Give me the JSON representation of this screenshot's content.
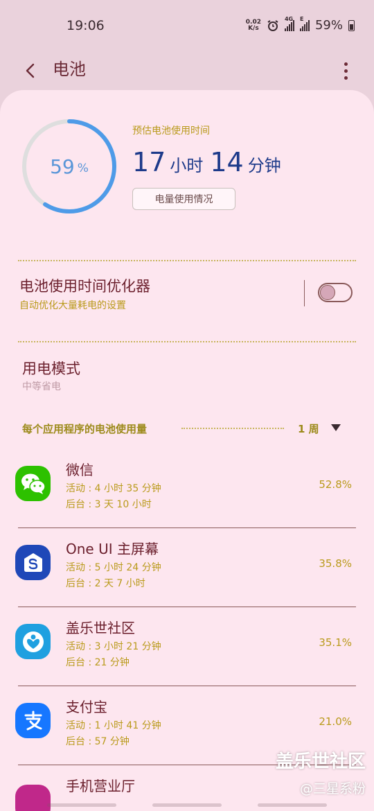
{
  "status_bar": {
    "time": "19:06",
    "net_speed_value": "0.02",
    "net_speed_unit": "K/s",
    "icons": [
      "alarm-icon",
      "4g-signal-icon",
      "e-signal-icon",
      "battery-icon"
    ],
    "net_4g": "4G",
    "net_e": "E",
    "battery": "59%"
  },
  "app_bar": {
    "title": "电池",
    "back_icon": "chevron-left-icon",
    "more_icon": "more-vertical-icon"
  },
  "battery": {
    "level_fraction": 0.59,
    "level_number": "59",
    "level_unit": "%",
    "ring_color": "#4e9be8",
    "estimate_label": "预估电池使用时间",
    "hours": "17",
    "hours_unit": "小时",
    "minutes": "14",
    "minutes_unit": "分钟",
    "usage_button": "电量使用情况"
  },
  "optimizer": {
    "title": "电池使用时间优化器",
    "subtitle": "自动优化大量耗电的设置",
    "enabled": false
  },
  "power_mode": {
    "title": "用电模式",
    "subtitle": "中等省电"
  },
  "app_usage": {
    "section_label": "每个应用程序的电池使用量",
    "period": "1 周",
    "apps": [
      {
        "name": "微信",
        "foreground": "活动 : 4 小时 35 分钟",
        "background": "后台 : 3 天 10 小时",
        "percent": "52.8%",
        "icon": "wechat-icon",
        "color": "#2dc100"
      },
      {
        "name": "One UI 主屏幕",
        "foreground": "活动 : 5 小时 24 分钟",
        "background": "后台 : 2 天 7 小时",
        "percent": "35.8%",
        "icon": "oneui-home-icon",
        "color": "#1f48b8"
      },
      {
        "name": "盖乐世社区",
        "foreground": "活动 : 3 小时 21 分钟",
        "background": "后台 : 21 分钟",
        "percent": "35.1%",
        "icon": "galaxy-community-icon",
        "color": "#1fa0e0"
      },
      {
        "name": "支付宝",
        "foreground": "活动 : 1 小时 41 分钟",
        "background": "后台 : 57 分钟",
        "percent": "21.0%",
        "icon": "alipay-icon",
        "color": "#1677ff"
      },
      {
        "name": "手机营业厅",
        "icon": "mobile-hall-icon",
        "color": "#c0288a"
      }
    ]
  },
  "watermark": {
    "line1": "盖乐世社区",
    "line2": "@三星系粉"
  }
}
